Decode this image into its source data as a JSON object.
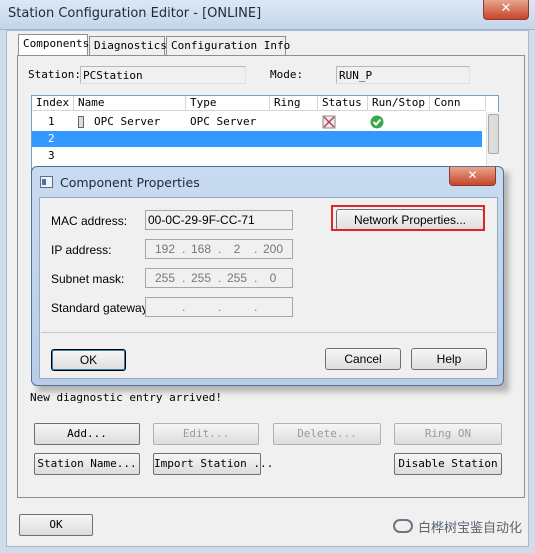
{
  "window": {
    "title": "Station Configuration Editor - [ONLINE]",
    "close_glyph": "✕"
  },
  "tabs": [
    {
      "label": "Components",
      "active": true
    },
    {
      "label": "Diagnostics",
      "active": false
    },
    {
      "label": "Configuration Info",
      "active": false
    }
  ],
  "station": {
    "label": "Station:",
    "value": "PCStation"
  },
  "mode": {
    "label": "Mode:",
    "value": "RUN_P"
  },
  "table": {
    "columns": [
      "Index",
      "Name",
      "Type",
      "Ring",
      "Status",
      "Run/Stop",
      "Conn"
    ],
    "rows": [
      {
        "index": "1",
        "name": "OPC Server",
        "type": "OPC Server",
        "ring": "",
        "status_icon": "status-ok-icon",
        "runstop_icon": "run-check-icon",
        "conn": "",
        "selected": false
      },
      {
        "index": "2",
        "name": "",
        "type": "",
        "ring": "",
        "conn": "",
        "selected": true
      },
      {
        "index": "3",
        "name": "",
        "type": "",
        "ring": "",
        "conn": "",
        "selected": false
      }
    ]
  },
  "status_message": "New diagnostic entry arrived!",
  "buttons": {
    "add": "Add...",
    "edit": "Edit...",
    "delete": "Delete...",
    "ring_on": "Ring ON",
    "station_name": "Station Name...",
    "import_station": "Import Station ...",
    "disable_station": "Disable Station",
    "ok": "OK"
  },
  "dialog": {
    "title": "Component Properties",
    "close_glyph": "✕",
    "mac_label": "MAC address:",
    "mac_value": "00-0C-29-9F-CC-71",
    "network_properties": "Network Properties...",
    "ip_label": "IP address:",
    "ip": [
      "192",
      "168",
      "2",
      "200"
    ],
    "subnet_label": "Subnet mask:",
    "subnet": [
      "255",
      "255",
      "255",
      "0"
    ],
    "gateway_label": "Standard gateway:",
    "gateway": [
      "",
      "",
      "",
      ""
    ],
    "ok": "OK",
    "cancel": "Cancel",
    "help": "Help"
  },
  "watermark": {
    "text": "白桦树宝鉴自动化"
  },
  "colors": {
    "selection": "#3399ff",
    "highlight_box": "#d7262d",
    "close_button": "#c7452a"
  }
}
